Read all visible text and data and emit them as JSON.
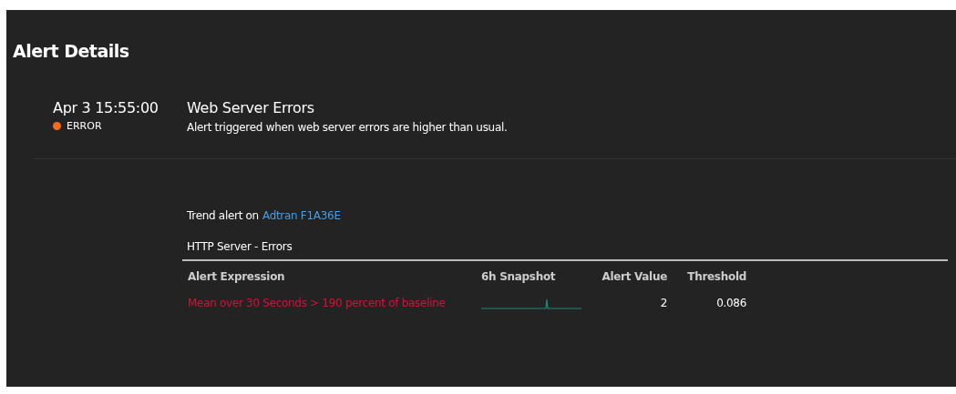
{
  "page": {
    "title": "Alert Details"
  },
  "alert": {
    "time": "Apr 3 15:55:00",
    "severity": "ERROR",
    "color": "#f26b21",
    "name": "Web Server Errors",
    "description": "Alert triggered when web server errors are higher than usual."
  },
  "trend": {
    "prefix": "Trend alert on",
    "device": "Adtran F1A36E"
  },
  "table": {
    "title": "HTTP Server - Errors",
    "columns": [
      "Alert Expression",
      "6h Snapshot",
      "Alert Value",
      "Threshold"
    ],
    "rows": [
      {
        "expression": "Mean over 30 Seconds > 190 percent of baseline",
        "value": "2",
        "threshold": "0.086"
      }
    ]
  }
}
